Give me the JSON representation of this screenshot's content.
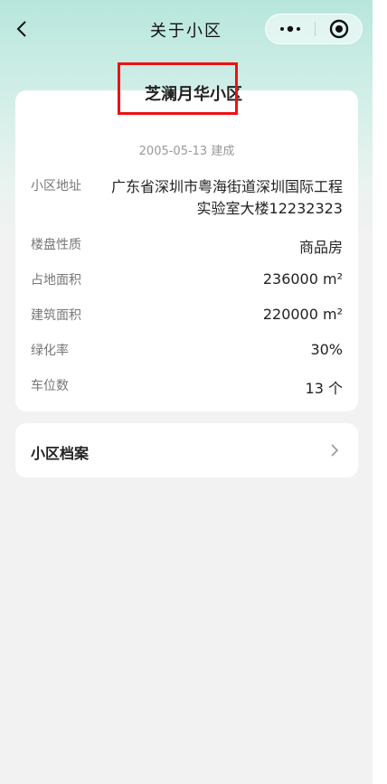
{
  "nav": {
    "title": "关于小区"
  },
  "community": {
    "name": "芝澜月华小区",
    "built": "2005-05-13 建成"
  },
  "details": [
    {
      "label": "小区地址",
      "value": "广东省深圳市粤海街道深圳国际工程实验室大楼12232323"
    },
    {
      "label": "楼盘性质",
      "value": "商品房"
    },
    {
      "label": "占地面积",
      "value": "236000 m²"
    },
    {
      "label": "建筑面积",
      "value": "220000 m²"
    },
    {
      "label": "绿化率",
      "value": "30%"
    },
    {
      "label": "车位数",
      "value": "13 个"
    }
  ],
  "archive": {
    "title": "小区档案"
  },
  "icons": {
    "back": "chevron-left-icon",
    "more": "more-dots-icon",
    "close": "target-circle-icon",
    "archive_arrow": "chevron-right-icon"
  },
  "colors": {
    "header_gradient": "#b7e6dc",
    "highlight_box": "#ee1111"
  }
}
